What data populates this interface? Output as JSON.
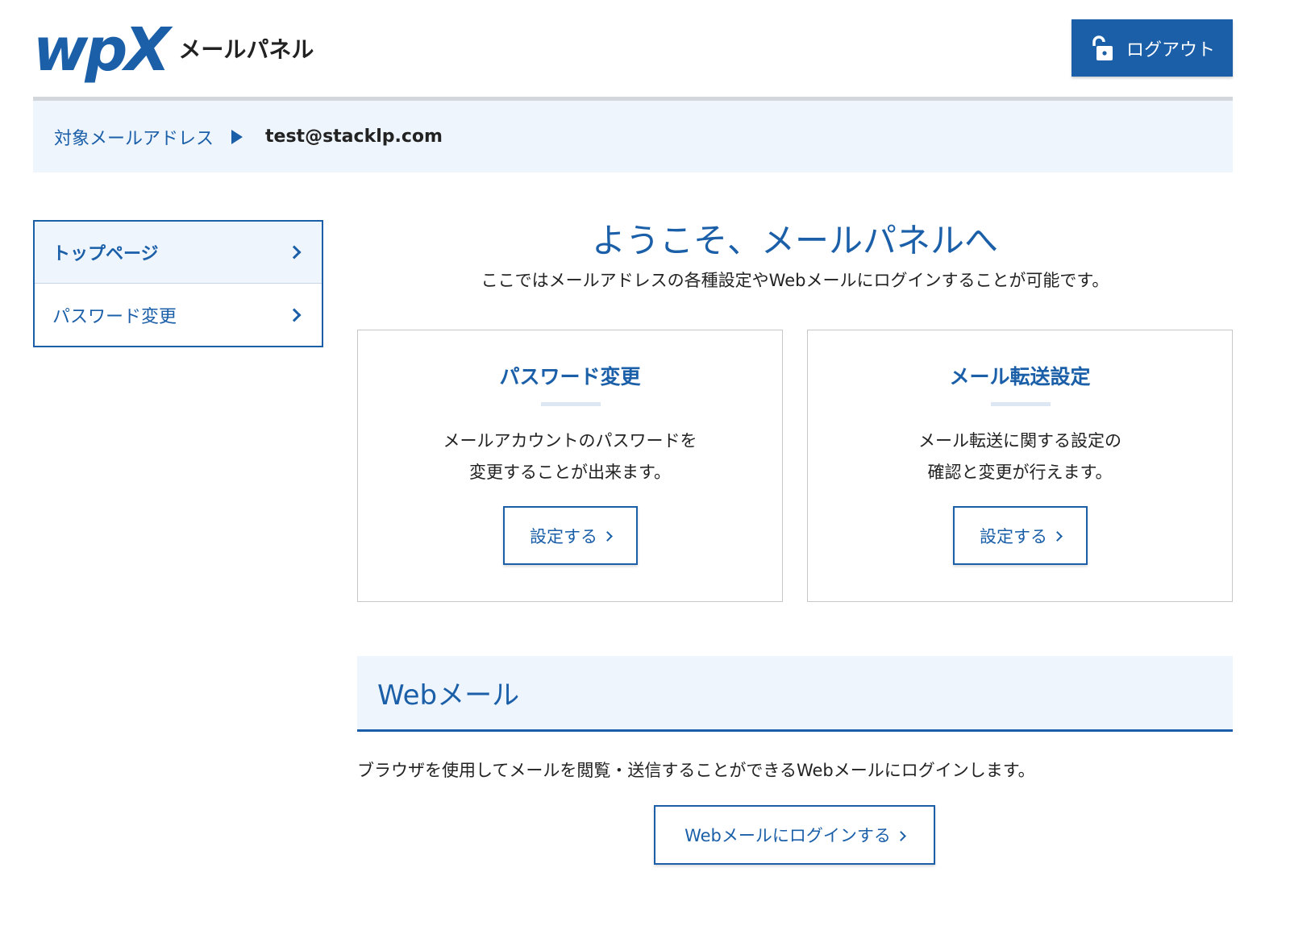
{
  "header": {
    "logo_mark": "wpX",
    "logo_text": "メールパネル",
    "logout_label": "ログアウト"
  },
  "address_bar": {
    "label": "対象メールアドレス",
    "value": "test@stacklp.com"
  },
  "sidebar": {
    "items": [
      {
        "label": "トップページ",
        "active": true
      },
      {
        "label": "パスワード変更",
        "active": false
      }
    ]
  },
  "welcome": {
    "title": "ようこそ、メールパネルへ",
    "subtitle": "ここではメールアドレスの各種設定やWebメールにログインすることが可能です。"
  },
  "cards": [
    {
      "title": "パスワード変更",
      "desc_line1": "メールアカウントのパスワードを",
      "desc_line2": "変更することが出来ます。",
      "button_label": "設定する"
    },
    {
      "title": "メール転送設定",
      "desc_line1": "メール転送に関する設定の",
      "desc_line2": "確認と変更が行えます。",
      "button_label": "設定する"
    }
  ],
  "webmail": {
    "title": "Webメール",
    "description": "ブラウザを使用してメールを閲覧・送信することができるWebメールにログインします。",
    "button_label": "Webメールにログインする"
  },
  "colors": {
    "brand_blue": "#1a5fa8",
    "light_bg": "#eff5fd"
  }
}
